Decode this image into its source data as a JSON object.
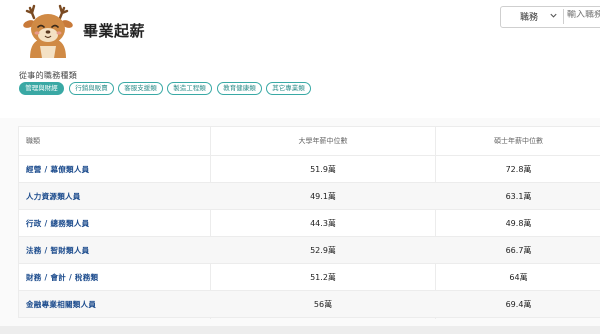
{
  "header": {
    "title": "畢業起薪",
    "search": {
      "select_value": "職務",
      "placeholder": "輸入職務"
    }
  },
  "filter": {
    "label": "從事的職務種類",
    "chips": [
      {
        "label": "管理與財經",
        "active": true
      },
      {
        "label": "行銷與販賣",
        "active": false
      },
      {
        "label": "客服支援類",
        "active": false
      },
      {
        "label": "製造工程類",
        "active": false
      },
      {
        "label": "教育健康類",
        "active": false
      },
      {
        "label": "其它專業類",
        "active": false
      }
    ]
  },
  "table": {
    "headers": {
      "job": "職類",
      "bachelor": "大學年薪中位數",
      "master": "碩士年薪中位數"
    },
    "rows": [
      {
        "job": "經營 / 幕僚類人員",
        "bachelor": "51.9萬",
        "master": "72.8萬"
      },
      {
        "job": "人力資源類人員",
        "bachelor": "49.1萬",
        "master": "63.1萬"
      },
      {
        "job": "行政 / 總務類人員",
        "bachelor": "44.3萬",
        "master": "49.8萬"
      },
      {
        "job": "法務 / 智財類人員",
        "bachelor": "52.9萬",
        "master": "66.7萬"
      },
      {
        "job": "財務 / 會計 / 稅務類",
        "bachelor": "51.2萬",
        "master": "64萬"
      },
      {
        "job": "金融專業相關類人員",
        "bachelor": "56萬",
        "master": "69.4萬"
      }
    ]
  },
  "colors": {
    "accent": "#3aa8a4",
    "link": "#1a4a8c"
  },
  "icons": {
    "avatar": "deer-mascot-icon",
    "dropdown": "chevron-down-icon"
  }
}
